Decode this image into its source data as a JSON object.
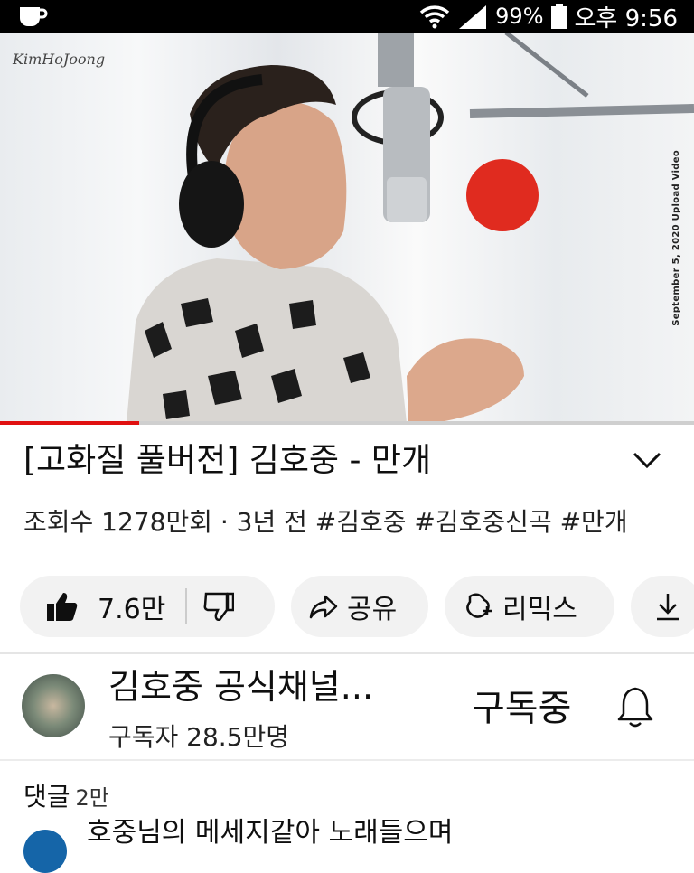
{
  "status_bar": {
    "battery": "99%",
    "time": "오후 9:56"
  },
  "video": {
    "watermark": "KimHoJoong",
    "side_caption": "September 5, 2020 Upload Video",
    "progress_fraction": 0.2
  },
  "title": "[고화질 풀버전] 김호중 - 만개",
  "meta": "조회수 1278만회 · 3년 전 #김호중 #김호중신곡 #만개",
  "actions": {
    "likes": "7.6만",
    "share": "공유",
    "remix": "리믹스"
  },
  "channel": {
    "name": "김호중 공식채널...",
    "subscribers": "구독자 28.5만명",
    "subscribe_state": "구독중"
  },
  "comments": {
    "label": "댓글",
    "count": "2만",
    "first_comment": "호중님의 메세지같아 노래들으며"
  }
}
